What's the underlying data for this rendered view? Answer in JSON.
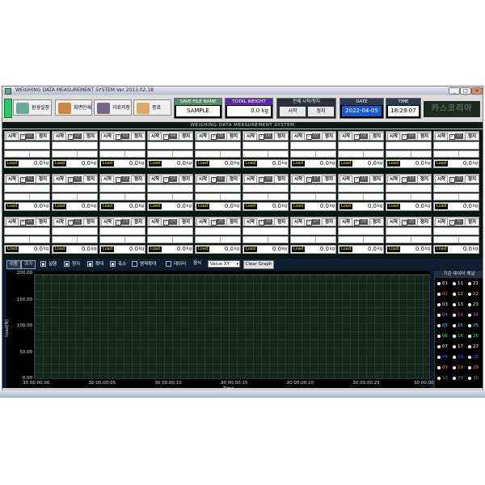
{
  "window": {
    "title": "WEIGHING DATA MEASUREMENT SYSTEM  Ver 2013.02.18"
  },
  "toolbar": {
    "buttons": [
      "환경설정",
      "화면인쇄",
      "자료저장",
      "종료"
    ]
  },
  "header": {
    "save_file_caption": "SAVE FILE NAME",
    "save_file_value": "SAMPLE",
    "total_weight_caption": "TOTAL WEIGHT",
    "total_weight_value": "0.0",
    "total_weight_unit": "kg",
    "all_control_caption": "전체 시작/정지",
    "all_start": "시작",
    "all_stop": "정지",
    "date_caption": "DATE",
    "date_value": "2022-04-05",
    "time_caption": "TIME",
    "time_value": "18:29:07",
    "brand": "카스코리아"
  },
  "system_title": "WEIGHING DATA MEASUREMENT SYSTEM",
  "cells": [
    {
      "num": "01",
      "value": "0.0"
    },
    {
      "num": "02",
      "value": "0.0"
    },
    {
      "num": "03",
      "value": "0.0"
    },
    {
      "num": "04",
      "value": "0.0"
    },
    {
      "num": "05",
      "value": "0.0"
    },
    {
      "num": "06",
      "value": "0.0"
    },
    {
      "num": "07",
      "value": "0.0"
    },
    {
      "num": "08",
      "value": "0.0"
    },
    {
      "num": "09",
      "value": "0.0"
    },
    {
      "num": "10",
      "value": "0.0"
    },
    {
      "num": "11",
      "value": "0.0"
    },
    {
      "num": "12",
      "value": "0.0"
    },
    {
      "num": "13",
      "value": "0.0"
    },
    {
      "num": "14",
      "value": "0.0"
    },
    {
      "num": "15",
      "value": "0.0"
    },
    {
      "num": "16",
      "value": "0.0"
    },
    {
      "num": "17",
      "value": "0.0"
    },
    {
      "num": "18",
      "value": "0.0"
    },
    {
      "num": "19",
      "value": "0.0"
    },
    {
      "num": "20",
      "value": "0.0"
    },
    {
      "num": "21",
      "value": "0.0"
    },
    {
      "num": "22",
      "value": "0.0"
    },
    {
      "num": "23",
      "value": "0.0"
    },
    {
      "num": "24",
      "value": "0.0"
    },
    {
      "num": "25",
      "value": "0.0"
    },
    {
      "num": "26",
      "value": "0.0"
    },
    {
      "num": "27",
      "value": "0.0"
    },
    {
      "num": "28",
      "value": "0.0"
    },
    {
      "num": "29",
      "value": "0.0"
    },
    {
      "num": "30",
      "value": "0.0"
    }
  ],
  "cell_labels": {
    "start": "시작",
    "stop": "정지",
    "load": "Load",
    "unit": "kg"
  },
  "graph_toolbar": {
    "tab_move": "이동",
    "tab_size": "크기",
    "checks": [
      "실행",
      "정지",
      "확대",
      "축소",
      "영역확대"
    ],
    "data_label": "데이터",
    "format_label": "형식",
    "format_value": "Value XY",
    "clear_button": "Clear Graph"
  },
  "chart_data": {
    "type": "line",
    "title": "",
    "xlabel": "Time",
    "ylabel": "Load[N]",
    "ylim": [
      0,
      200
    ],
    "yticks": [
      "200.00",
      "150.00",
      "100.00",
      "50.00",
      "0.00"
    ],
    "xticks": [
      "30 00:00:00",
      "30 00:00:05",
      "30 00:00:10",
      "30 00:00:15",
      "30 00:00:20",
      "30 00:00:25",
      "30 00:00:30"
    ],
    "series": []
  },
  "legend": {
    "title": "기준 데이터 해널",
    "items": [
      {
        "label": "01",
        "color": "#ffffff"
      },
      {
        "label": "11",
        "color": "#ffffff"
      },
      {
        "label": "21",
        "color": "#ffffff"
      },
      {
        "label": "02",
        "color": "#ff8c00"
      },
      {
        "label": "12",
        "color": "#ffd700"
      },
      {
        "label": "22",
        "color": "#ffd700"
      },
      {
        "label": "03",
        "color": "#ffffff"
      },
      {
        "label": "13",
        "color": "#ffffff"
      },
      {
        "label": "23",
        "color": "#ffffff"
      },
      {
        "label": "04",
        "color": "#ff3cff"
      },
      {
        "label": "14",
        "color": "#ff3cff"
      },
      {
        "label": "24",
        "color": "#ff3cff"
      },
      {
        "label": "05",
        "color": "#39e6ff"
      },
      {
        "label": "15",
        "color": "#39e6ff"
      },
      {
        "label": "25",
        "color": "#39e6ff"
      },
      {
        "label": "06",
        "color": "#3cff3c"
      },
      {
        "label": "16",
        "color": "#3cff3c"
      },
      {
        "label": "26",
        "color": "#3cff3c"
      },
      {
        "label": "07",
        "color": "#ffffff"
      },
      {
        "label": "17",
        "color": "#ffffff"
      },
      {
        "label": "27",
        "color": "#ffffff"
      },
      {
        "label": "08",
        "color": "#4060ff"
      },
      {
        "label": "18",
        "color": "#4060ff"
      },
      {
        "label": "28",
        "color": "#4060ff"
      },
      {
        "label": "09",
        "color": "#ff8c00"
      },
      {
        "label": "19",
        "color": "#ff8c00"
      },
      {
        "label": "29",
        "color": "#ff8c00"
      },
      {
        "label": "10",
        "color": "#888888"
      },
      {
        "label": "20",
        "color": "#888888"
      },
      {
        "label": "30",
        "color": "#888888"
      }
    ]
  }
}
